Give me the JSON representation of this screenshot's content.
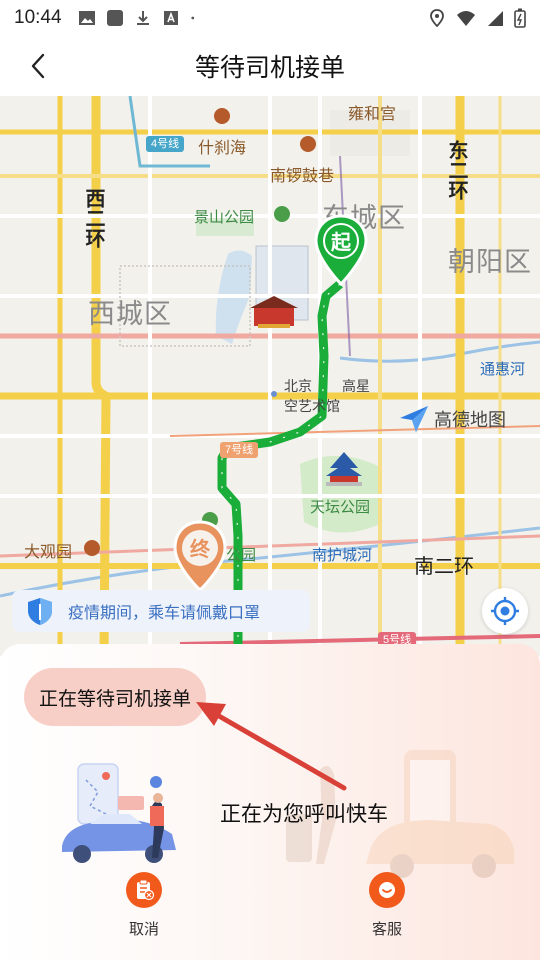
{
  "status_bar": {
    "time": "10:44",
    "left_icons": [
      "image-icon",
      "app-icon",
      "download-icon",
      "font-icon",
      "dot-icon"
    ],
    "right_icons": [
      "location-icon",
      "wifi-icon",
      "signal-icon",
      "battery-icon"
    ]
  },
  "header": {
    "title": "等待司机接单",
    "back_icon": "chevron-left-icon"
  },
  "map": {
    "districts": {
      "dongcheng": "东城区",
      "xicheng": "西城区",
      "chaoyang": "朝阳区"
    },
    "roads": {
      "west_2nd_ring": "西二环",
      "east_2nd_ring": "东二环",
      "south_2nd_ring": "南二环"
    },
    "pois": {
      "yonghegong": "雍和宫",
      "shichahai": "什刹海",
      "nanluoguxiang": "南锣鼓巷",
      "jingshan": "景山公园",
      "tiantan": "天坛公园",
      "daguanyuan": "大观园",
      "park_partial": "公园",
      "theater_prefix": "北京",
      "theater_line1_rest": "高星",
      "theater_line2": "空艺术馆",
      "tonghuihe": "通惠河",
      "nanhucheng": "南护城河"
    },
    "subway_lines": {
      "line4": "4号线",
      "line7": "7号线",
      "line5": "5号线"
    },
    "markers": {
      "start": "起",
      "end": "终"
    },
    "logo": "高德地图",
    "notice": "疫情期间，乘车请佩戴口罩",
    "colors": {
      "route": "#1aad3a",
      "start_marker": "#1aad3a",
      "end_marker": "#e8925e"
    }
  },
  "panel": {
    "status_pill": "正在等待司机接单",
    "calling_text": "正在为您呼叫快车",
    "actions": [
      {
        "label": "取消",
        "icon": "cancel-order-icon"
      },
      {
        "label": "客服",
        "icon": "customer-service-icon"
      }
    ],
    "accent_color": "#f25a1c"
  }
}
